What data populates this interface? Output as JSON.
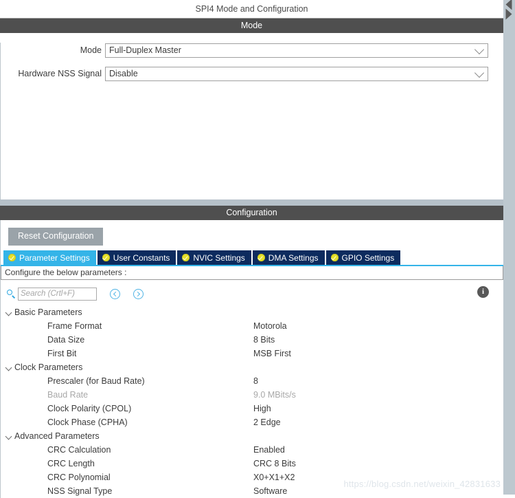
{
  "window": {
    "title": "SPI4 Mode and Configuration"
  },
  "mode_section": {
    "band_title": "Mode",
    "fields": [
      {
        "label": "Mode",
        "value": "Full-Duplex Master",
        "icon": "chevron-down-icon"
      },
      {
        "label": "Hardware NSS Signal",
        "value": "Disable",
        "icon": "chevron-down-icon"
      }
    ]
  },
  "config_section": {
    "band_title": "Configuration",
    "reset_button": "Reset Configuration",
    "tabs": [
      {
        "label": "Parameter Settings",
        "active": true,
        "icon": "check-circle-icon"
      },
      {
        "label": "User Constants",
        "active": false,
        "icon": "check-circle-icon"
      },
      {
        "label": "NVIC Settings",
        "active": false,
        "icon": "check-circle-icon"
      },
      {
        "label": "DMA Settings",
        "active": false,
        "icon": "check-circle-icon"
      },
      {
        "label": "GPIO Settings",
        "active": false,
        "icon": "check-circle-icon"
      }
    ],
    "hint": "Configure the below parameters :",
    "search": {
      "placeholder": "Search (Crtl+F)",
      "value": "",
      "icon": "search-icon",
      "prev_icon": "chevron-left-circle-icon",
      "next_icon": "chevron-right-circle-icon",
      "info_icon": "info-icon",
      "info_glyph": "i"
    },
    "parameters": [
      {
        "type": "group",
        "label": "Basic Parameters",
        "value": "",
        "disabled": false
      },
      {
        "type": "item",
        "label": "Frame Format",
        "value": "Motorola",
        "disabled": false
      },
      {
        "type": "item",
        "label": "Data Size",
        "value": "8 Bits",
        "disabled": false
      },
      {
        "type": "item",
        "label": "First Bit",
        "value": "MSB First",
        "disabled": false
      },
      {
        "type": "group",
        "label": "Clock Parameters",
        "value": "",
        "disabled": false
      },
      {
        "type": "item",
        "label": "Prescaler (for Baud Rate)",
        "value": "8",
        "disabled": false
      },
      {
        "type": "item",
        "label": "Baud Rate",
        "value": "9.0 MBits/s",
        "disabled": true
      },
      {
        "type": "item",
        "label": "Clock Polarity (CPOL)",
        "value": "High",
        "disabled": false
      },
      {
        "type": "item",
        "label": "Clock Phase (CPHA)",
        "value": "2 Edge",
        "disabled": false
      },
      {
        "type": "group",
        "label": "Advanced Parameters",
        "value": "",
        "disabled": false
      },
      {
        "type": "item",
        "label": "CRC Calculation",
        "value": "Enabled",
        "disabled": false
      },
      {
        "type": "item",
        "label": "CRC Length",
        "value": "CRC 8 Bits",
        "disabled": false
      },
      {
        "type": "item",
        "label": "CRC Polynomial",
        "value": "X0+X1+X2",
        "disabled": false
      },
      {
        "type": "item",
        "label": "NSS Signal Type",
        "value": "Software",
        "disabled": false
      }
    ]
  },
  "scrollbar": {
    "up_icon": "triangle-up-icon",
    "down_icon": "triangle-down-icon"
  },
  "watermark": {
    "text": "https://blog.csdn.net/weixin_42831633"
  },
  "colors": {
    "band": "#4f4f4f",
    "tab_active": "#34b4e8",
    "tab_inactive": "#0d2b5e",
    "check": "#e6e02a",
    "accent": "#2fa8e0",
    "reset_button": "#9aa3a9",
    "scrollbar": "#bdc8cf"
  }
}
